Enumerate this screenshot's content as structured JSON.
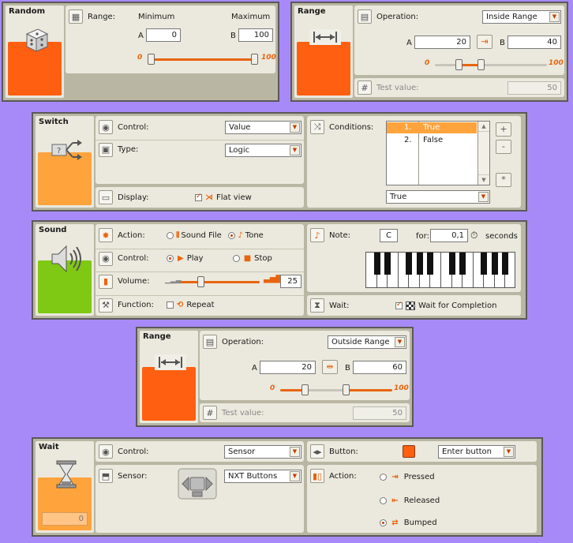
{
  "random": {
    "title": "Random",
    "range_label": "Range:",
    "minimum_label": "Minimum",
    "maximum_label": "Maximum",
    "a_label": "A",
    "b_label": "B",
    "a_value": "0",
    "b_value": "100",
    "slider_min": "0",
    "slider_max": "100",
    "slider_a_fraction": 0.0,
    "slider_b_fraction": 1.0
  },
  "range1": {
    "title": "Range",
    "operation_label": "Operation:",
    "operation_value": "Inside Range",
    "a_label": "A",
    "b_label": "B",
    "a_value": "20",
    "b_value": "40",
    "slider_min": "0",
    "slider_max": "100",
    "test_label": "Test value:",
    "test_value": "50"
  },
  "switch": {
    "title": "Switch",
    "control_label": "Control:",
    "control_value": "Value",
    "type_label": "Type:",
    "type_value": "Logic",
    "display_label": "Display:",
    "flat_view_label": "Flat view",
    "conditions_label": "Conditions:",
    "conditions": [
      {
        "num": "1.",
        "value": "True"
      },
      {
        "num": "2.",
        "value": "False"
      }
    ],
    "selected_condition_value": "True",
    "add_glyph": "+",
    "remove_glyph": "-",
    "default_glyph": "*"
  },
  "sound": {
    "title": "Sound",
    "action_label": "Action:",
    "sound_file_label": "Sound File",
    "tone_label": "Tone",
    "control_label": "Control:",
    "play_label": "Play",
    "stop_label": "Stop",
    "volume_label": "Volume:",
    "volume_value": "25",
    "function_label": "Function:",
    "repeat_label": "Repeat",
    "note_label": "Note:",
    "note_value": "C",
    "for_label": "for:",
    "duration_value": "0,1",
    "seconds_label": "seconds",
    "wait_label": "Wait:",
    "wait_completion_label": "Wait for Completion"
  },
  "range2": {
    "title": "Range",
    "operation_label": "Operation:",
    "operation_value": "Outside Range",
    "a_label": "A",
    "b_label": "B",
    "a_value": "20",
    "b_value": "60",
    "slider_min": "0",
    "slider_max": "100",
    "test_label": "Test value:",
    "test_value": "50"
  },
  "wait": {
    "title": "Wait",
    "counter_value": "0",
    "control_label": "Control:",
    "control_value": "Sensor",
    "sensor_label": "Sensor:",
    "sensor_value": "NXT Buttons",
    "button_label": "Button:",
    "button_value": "Enter button",
    "action_label": "Action:",
    "pressed_label": "Pressed",
    "released_label": "Released",
    "bumped_label": "Bumped"
  },
  "colors": {
    "background": "#a78af8",
    "orange": "#ff5f10",
    "light_orange": "#ffa43c",
    "green": "#7fc813",
    "accent": "#e8640e",
    "selected_condition": "#ffa43c"
  }
}
